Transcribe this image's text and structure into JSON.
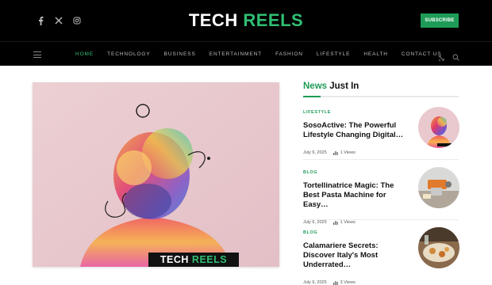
{
  "header": {
    "logo_main": "TECH",
    "logo_accent": "REELS",
    "subscribe_label": "SUBSCRIBE",
    "social_icons": [
      "facebook-icon",
      "x-icon",
      "instagram-icon"
    ]
  },
  "nav": {
    "items": [
      {
        "label": "HOME",
        "active": true
      },
      {
        "label": "TECHNOLOGY",
        "active": false
      },
      {
        "label": "BUSINESS",
        "active": false
      },
      {
        "label": "ENTERTAINMENT",
        "active": false
      },
      {
        "label": "FASHION",
        "active": false
      },
      {
        "label": "LIFESTYLE",
        "active": false
      },
      {
        "label": "HEALTH",
        "active": false
      },
      {
        "label": "CONTACT US",
        "active": false
      }
    ],
    "icons": [
      "theme-toggle-icon",
      "search-icon"
    ]
  },
  "hero": {
    "badge_main": "TECH",
    "badge_accent": "REELS"
  },
  "sidebar": {
    "heading_accent": "News",
    "heading_rest": "Just In",
    "posts": [
      {
        "category": "LIFESTYLE",
        "title": "SosoActive: The Powerful Lifestyle Changing Digital…",
        "date": "July 9, 2025",
        "views": "1 Views"
      },
      {
        "category": "BLOG",
        "title": "Tortellinatrice Magic: The Best Pasta Machine for Easy…",
        "date": "July 9, 2025",
        "views": "1 Views"
      },
      {
        "category": "BLOG",
        "title": "Calamariere Secrets: Discover Italy's Most Underrated…",
        "date": "July 9, 2025",
        "views": "3 Views"
      }
    ]
  },
  "colors": {
    "accent": "#1e9c57",
    "header_bg": "#000000"
  }
}
